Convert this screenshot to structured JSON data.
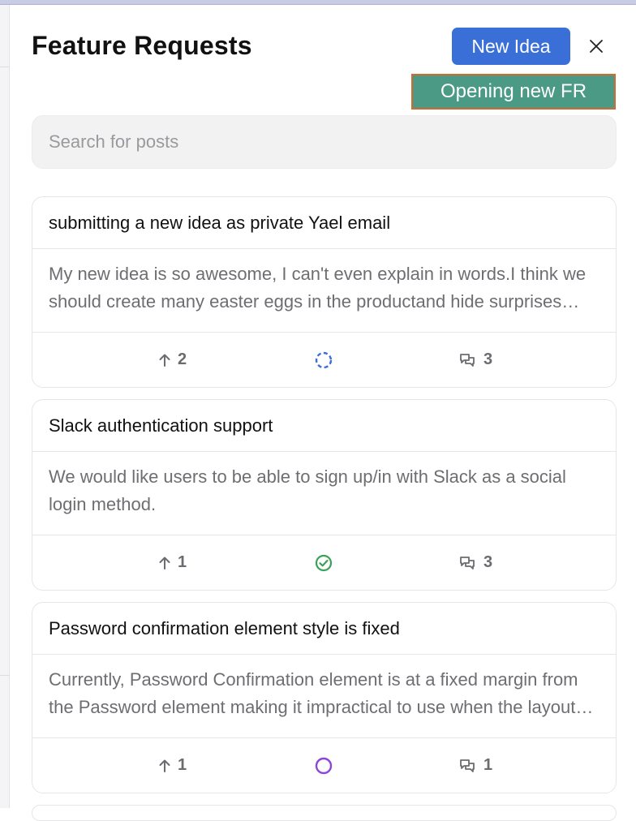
{
  "header": {
    "title": "Feature Requests",
    "new_idea_label": "New Idea",
    "tooltip": "Opening new FR"
  },
  "search": {
    "placeholder": "Search for posts"
  },
  "colors": {
    "primary": "#3a6fd8",
    "tooltip_bg": "#4a9a86",
    "tooltip_border": "#d06a2e",
    "status_in_progress": "#3a6fd8",
    "status_done": "#3aa257",
    "status_open": "#8e44d9"
  },
  "posts": [
    {
      "title": "submitting a new idea as private Yael email",
      "body": "My new idea is so awesome, I can't even explain in words.I think we should create many easter eggs in the productand hide surprises everywhere for our users to find.",
      "votes": "2",
      "status_icon": "in-progress-icon",
      "comments": "3"
    },
    {
      "title": "Slack authentication support",
      "body": "We would like users to be able to sign up/in with Slack as a social login method.",
      "votes": "1",
      "status_icon": "completed-icon",
      "comments": "3"
    },
    {
      "title": "Password confirmation element style is fixed",
      "body": "Currently, Password Confirmation element is at a fixed margin from the Password element making it impractical to use when the layout changes.",
      "votes": "1",
      "status_icon": "open-status-icon",
      "comments": "1"
    }
  ]
}
